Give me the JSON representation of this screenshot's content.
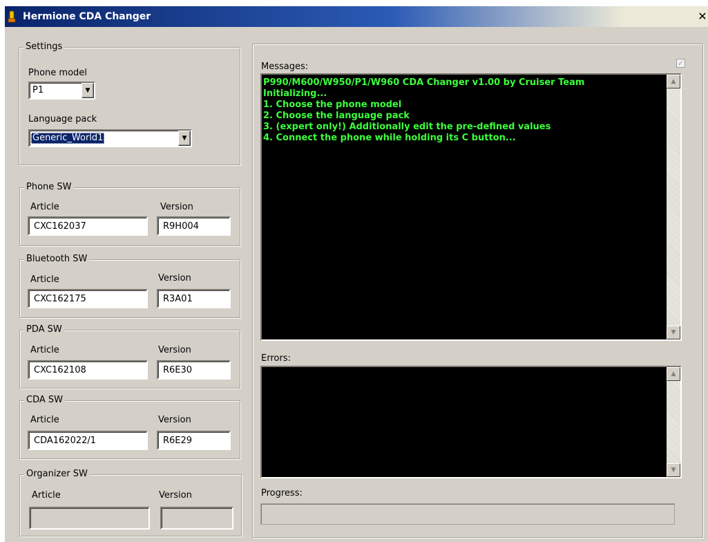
{
  "window": {
    "title": "Hermione CDA Changer",
    "close_glyph": "✕",
    "icon": "app-icon"
  },
  "settings": {
    "legend": "Settings",
    "phone_model_label": "Phone model",
    "phone_model_value": "P1",
    "language_pack_label": "Language pack",
    "language_pack_value": "Generic_World1"
  },
  "sw_groups": {
    "phone": {
      "legend": "Phone SW",
      "article_label": "Article",
      "version_label": "Version",
      "article": "CXC162037",
      "version": "R9H004"
    },
    "bluetooth": {
      "legend": "Bluetooth SW",
      "article_label": "Article",
      "version_label": "Version",
      "article": "CXC162175",
      "version": "R3A01"
    },
    "pda": {
      "legend": "PDA SW",
      "article_label": "Article",
      "version_label": "Version",
      "article": "CXC162108",
      "version": "R6E30"
    },
    "cda": {
      "legend": "CDA SW",
      "article_label": "Article",
      "version_label": "Version",
      "article": "CDA162022/1",
      "version": "R6E29"
    },
    "organizer": {
      "legend": "Organizer SW",
      "article_label": "Article",
      "version_label": "Version",
      "article": "",
      "version": ""
    }
  },
  "messages": {
    "label": "Messages:",
    "checkbox_checked": true,
    "lines": [
      "P990/M600/W950/P1/W960 CDA Changer v1.00 by Cruiser Team",
      "Initializing...",
      "1. Choose the phone model",
      "2. Choose the language pack",
      "3. (expert only!) Additionally edit the pre-defined values",
      "4. Connect the phone while holding its C button..."
    ]
  },
  "errors": {
    "label": "Errors:",
    "lines": []
  },
  "progress": {
    "label": "Progress:",
    "value": 0
  },
  "colors": {
    "console_bg": "#000000",
    "console_text": "#3cff3c",
    "titlebar": "#0a246a",
    "face": "#d4d0c8"
  },
  "glyphs": {
    "dropdown": "▼",
    "scroll_up": "▲",
    "scroll_down": "▼",
    "check": "✓"
  }
}
